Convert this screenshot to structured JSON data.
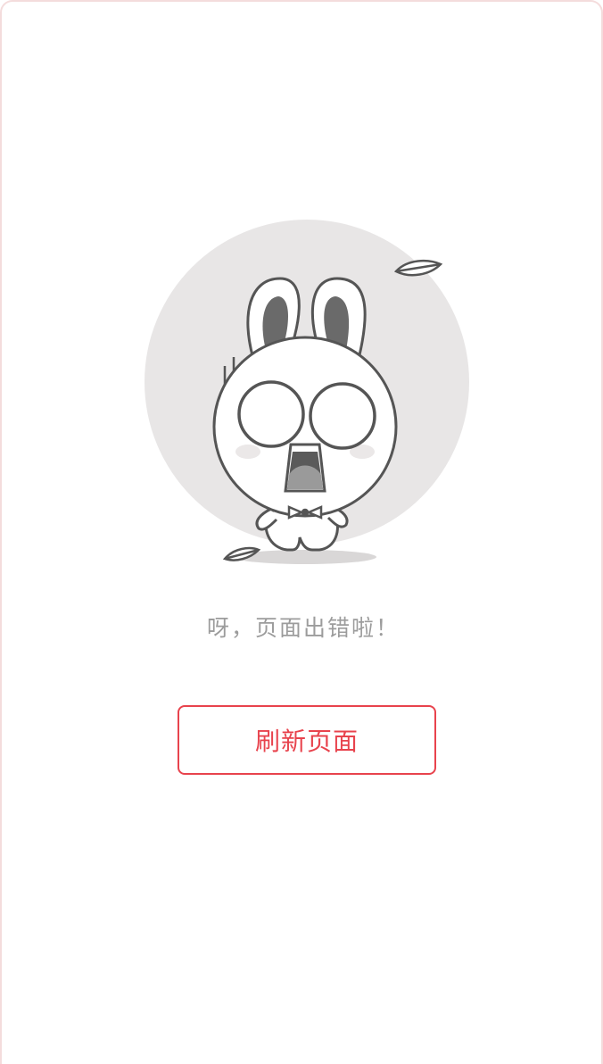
{
  "illustration": {
    "icon": "surprised-rabbit-error-illustration",
    "background_circle_color": "#e8e6e6",
    "stroke_color": "#555555"
  },
  "error": {
    "message": "呀，页面出错啦！"
  },
  "actions": {
    "refresh_label": "刷新页面",
    "accent_color": "#e8434d"
  }
}
